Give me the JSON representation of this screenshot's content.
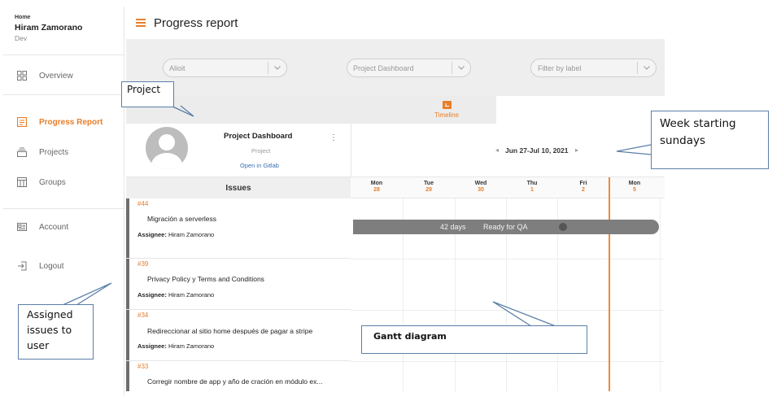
{
  "sidebar": {
    "home_label": "Home",
    "user_name": "Hiram Zamorano",
    "user_role": "Dev",
    "items": [
      {
        "label": "Overview",
        "icon": "grid-icon"
      },
      {
        "label": "Progress Report",
        "icon": "report-icon",
        "active": true
      },
      {
        "label": "Projects",
        "icon": "stack-icon"
      },
      {
        "label": "Groups",
        "icon": "table-icon"
      },
      {
        "label": "Account",
        "icon": "id-card-icon"
      },
      {
        "label": "Logout",
        "icon": "logout-icon"
      }
    ]
  },
  "header": {
    "title": "Progress report",
    "accent_color": "#e87e2a"
  },
  "filters": {
    "group_placeholder": "Alioit",
    "project_placeholder": "Project Dashboard",
    "label_placeholder": "Filter by label"
  },
  "tabs": {
    "timeline_label": "Timeline"
  },
  "project": {
    "name": "Project Dashboard",
    "type": "Project",
    "link_label": "Open in Gitlab"
  },
  "week": {
    "range": "Jun 27-Jul 10, 2021"
  },
  "issues_header": "Issues",
  "days": [
    {
      "name": "Mon",
      "date": "28"
    },
    {
      "name": "Tue",
      "date": "29"
    },
    {
      "name": "Wed",
      "date": "30"
    },
    {
      "name": "Thu",
      "date": "1"
    },
    {
      "name": "Fri",
      "date": "2"
    },
    {
      "name": "Mon",
      "date": "5"
    }
  ],
  "issues": [
    {
      "number": "#44",
      "title": "Migración a serverless",
      "assignee_label": "Assignee:",
      "assignee": "Hiram Zamorano"
    },
    {
      "number": "#39",
      "title": "Privacy Policy y Terms and Conditions",
      "assignee_label": "Assignee:",
      "assignee": "Hiram Zamorano"
    },
    {
      "number": "#34",
      "title": "Redireccionar al sitio home después de pagar a stripe",
      "assignee_label": "Assignee:",
      "assignee": "Hiram Zamorano"
    },
    {
      "number": "#33",
      "title": "Corregir nombre de app y año de cración en módulo ex...",
      "assignee_label": "",
      "assignee": ""
    }
  ],
  "gantt_bar": {
    "days": "42 days",
    "status": "Ready for QA"
  },
  "annotations": {
    "project": "Project",
    "week": "Week starting sundays",
    "assigned": "Assigned issues to user",
    "gantt": "Gantt diagram"
  }
}
